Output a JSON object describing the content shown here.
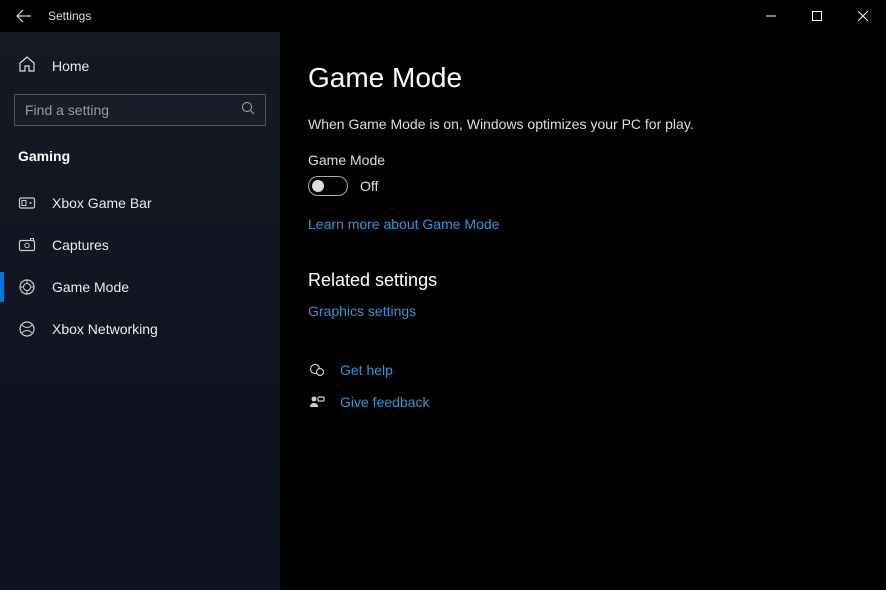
{
  "window": {
    "title": "Settings"
  },
  "sidebar": {
    "home_label": "Home",
    "search_placeholder": "Find a setting",
    "category": "Gaming",
    "items": [
      {
        "label": "Xbox Game Bar",
        "icon": "gamebar-icon",
        "active": false
      },
      {
        "label": "Captures",
        "icon": "captures-icon",
        "active": false
      },
      {
        "label": "Game Mode",
        "icon": "gamemode-icon",
        "active": true
      },
      {
        "label": "Xbox Networking",
        "icon": "xbox-icon",
        "active": false
      }
    ]
  },
  "page": {
    "title": "Game Mode",
    "description": "When Game Mode is on, Windows optimizes your PC for play.",
    "toggle_label": "Game Mode",
    "toggle_state": "Off",
    "learn_more": "Learn more about Game Mode",
    "related_heading": "Related settings",
    "graphics_link": "Graphics settings",
    "help_link": "Get help",
    "feedback_link": "Give feedback"
  }
}
